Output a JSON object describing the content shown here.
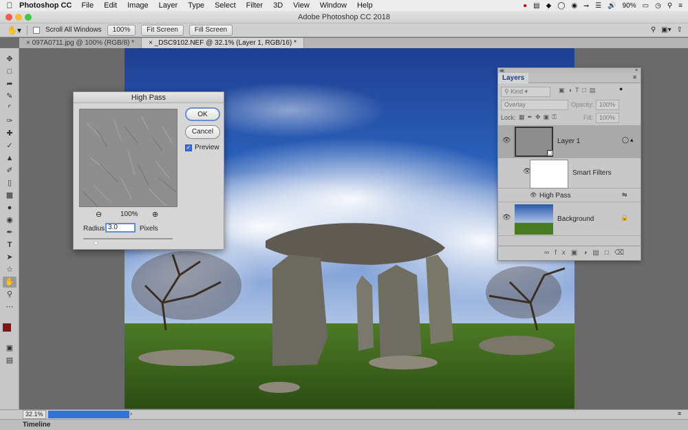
{
  "menubar": {
    "app_name": "Photoshop CC",
    "items": [
      "File",
      "Edit",
      "Image",
      "Layer",
      "Type",
      "Select",
      "Filter",
      "3D",
      "View",
      "Window",
      "Help"
    ],
    "battery": "90%"
  },
  "window": {
    "title": "Adobe Photoshop CC 2018"
  },
  "options": {
    "scroll_all_windows": "Scroll All Windows",
    "btn_100": "100%",
    "btn_fit": "Fit Screen",
    "btn_fill": "Fill Screen"
  },
  "tabs": [
    {
      "label": "097A0711.jpg @ 100% (RGB/8) *"
    },
    {
      "label": "_DSC9102.NEF @ 32.1% (Layer 1, RGB/16) *"
    }
  ],
  "highpass": {
    "title": "High Pass",
    "ok": "OK",
    "cancel": "Cancel",
    "preview": "Preview",
    "zoom": "100%",
    "radius_label": "Radius:",
    "radius_value": "3.0",
    "radius_unit": "Pixels"
  },
  "layers": {
    "title": "Layers",
    "filter_kind": "Kind",
    "blend_mode": "Overlay",
    "opacity_label": "Opacity:",
    "opacity_value": "100%",
    "lock_label": "Lock:",
    "fill_label": "Fill:",
    "fill_value": "100%",
    "items": [
      {
        "name": "Layer 1"
      },
      {
        "name": "Smart Filters"
      },
      {
        "name": "High Pass"
      },
      {
        "name": "Background"
      }
    ]
  },
  "status": {
    "zoom": "32.1%"
  },
  "timeline": {
    "label": "Timeline"
  },
  "colors": {
    "foreground": "#8b1010",
    "background": "#e8a32a"
  }
}
